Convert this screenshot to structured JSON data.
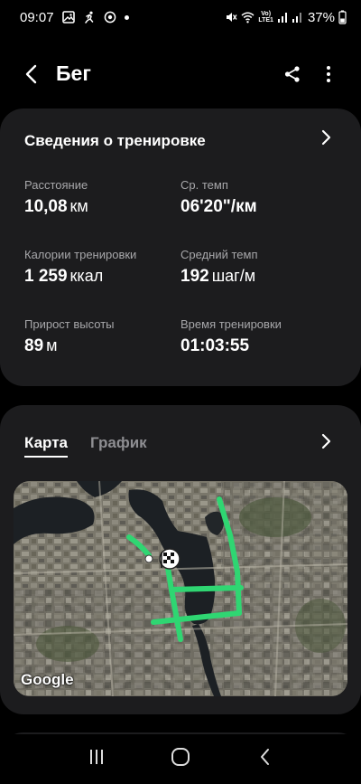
{
  "status_bar": {
    "time": "09:07",
    "battery": "37%",
    "lte_top": "Vo)",
    "lte_bottom": "LTE1"
  },
  "app_bar": {
    "title": "Бег"
  },
  "workout": {
    "header": "Сведения о тренировке",
    "stats": [
      {
        "label": "Расстояние",
        "value": "10,08",
        "unit": "км"
      },
      {
        "label": "Ср. темп",
        "value": "06'20\"/км",
        "unit": ""
      },
      {
        "label": "Калории тренировки",
        "value": "1 259",
        "unit": "ккал"
      },
      {
        "label": "Средний темп",
        "value": "192",
        "unit": "шаг/м"
      },
      {
        "label": "Прирост высоты",
        "value": "89",
        "unit": "м"
      },
      {
        "label": "Время тренировки",
        "value": "01:03:55",
        "unit": ""
      }
    ]
  },
  "map_card": {
    "tab_map": "Карта",
    "tab_chart": "График",
    "attribution": "Google"
  },
  "colors": {
    "route": "#2fd672",
    "card_bg": "#1c1c1e",
    "label_gray": "#a7a7aa"
  }
}
